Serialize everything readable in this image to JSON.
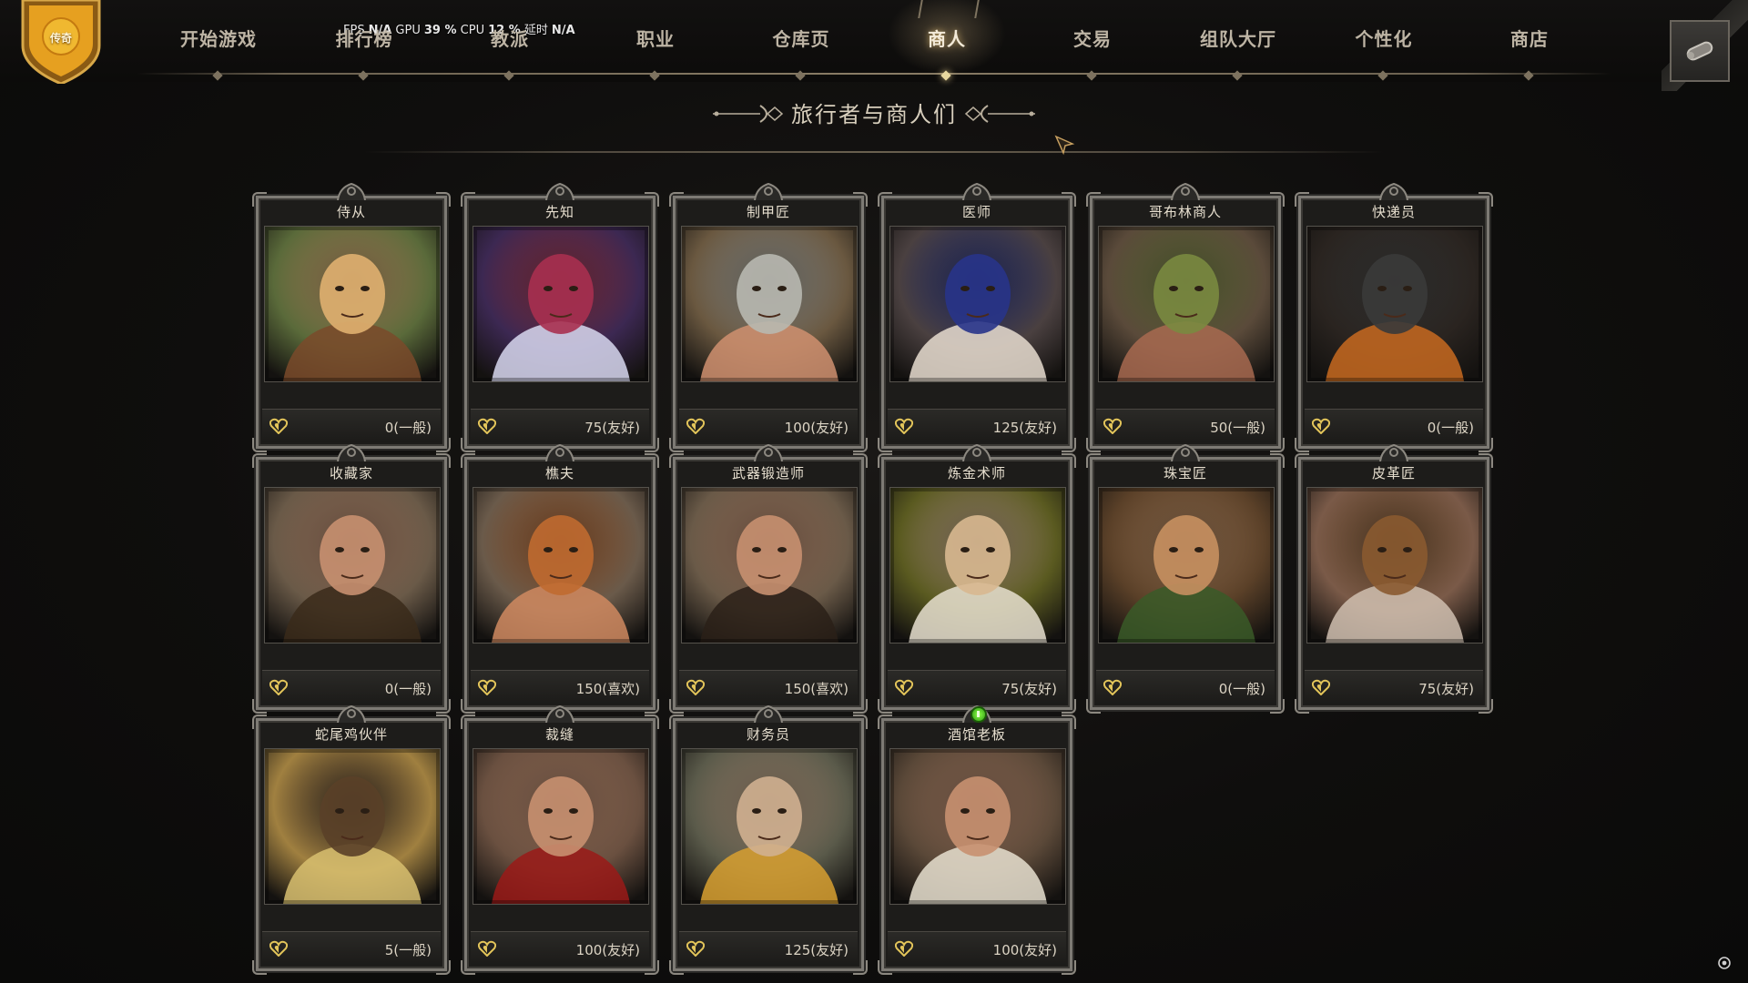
{
  "rank": {
    "label": "传奇"
  },
  "perf": {
    "fps_label": "FPS",
    "fps_value": "N/A",
    "gpu_label": "GPU",
    "gpu_value": "39 %",
    "cpu_label": "CPU",
    "cpu_value": "12 %",
    "latency_label": "延时",
    "latency_value": "N/A"
  },
  "nav": {
    "active": "商人",
    "items": [
      "开始游戏",
      "排行榜",
      "教派",
      "职业",
      "仓库页",
      "商人",
      "交易",
      "组队大厅",
      "个性化",
      "商店"
    ]
  },
  "section": {
    "title": "旅行者与商人们"
  },
  "colors": {
    "accent_gold": "#e3c55a",
    "alert_green": "#5ad12a",
    "text_light": "#e6dece"
  },
  "merchants": [
    {
      "name": "侍从",
      "rep": "0(一般)",
      "palette": [
        "#5a6a3a",
        "#e0b070",
        "#7a4a2a"
      ]
    },
    {
      "name": "先知",
      "rep": "75(友好)",
      "palette": [
        "#3c2852",
        "#a83050",
        "#d8d8f0"
      ]
    },
    {
      "name": "制甲匠",
      "rep": "100(友好)",
      "palette": [
        "#6a5840",
        "#b8b8b0",
        "#d09070"
      ]
    },
    {
      "name": "医师",
      "rep": "125(友好)",
      "palette": [
        "#4a4040",
        "#28348a",
        "#e8ddd0"
      ]
    },
    {
      "name": "哥布林商人",
      "rep": "50(一般)",
      "palette": [
        "#5a4a3a",
        "#7a8a40",
        "#a86a50"
      ]
    },
    {
      "name": "快递员",
      "rep": "0(一般)",
      "palette": [
        "#2a2420",
        "#3a3a3a",
        "#c86a20"
      ]
    },
    {
      "name": "收藏家",
      "rep": "0(一般)",
      "palette": [
        "#6a5a48",
        "#c89070",
        "#3a2a1a"
      ]
    },
    {
      "name": "樵夫",
      "rep": "150(喜欢)",
      "palette": [
        "#6a5a4a",
        "#c06a30",
        "#d08a60"
      ]
    },
    {
      "name": "武器锻造师",
      "rep": "150(喜欢)",
      "palette": [
        "#6a5a48",
        "#c89070",
        "#2a2018"
      ]
    },
    {
      "name": "炼金术师",
      "rep": "75(友好)",
      "palette": [
        "#5a5a20",
        "#d8b890",
        "#e8e0d0"
      ]
    },
    {
      "name": "珠宝匠",
      "rep": "0(一般)",
      "palette": [
        "#5a4028",
        "#c89060",
        "#3a5a28"
      ]
    },
    {
      "name": "皮革匠",
      "rep": "75(友好)",
      "palette": [
        "#7a5a48",
        "#8a5a30",
        "#d0c0b0"
      ]
    },
    {
      "name": "蛇尾鸡伙伴",
      "rep": "5(一般)",
      "palette": [
        "#a08040",
        "#5a4028",
        "#d8c070"
      ]
    },
    {
      "name": "裁缝",
      "rep": "100(友好)",
      "palette": [
        "#6a5040",
        "#c89070",
        "#9a1a18"
      ]
    },
    {
      "name": "财务员",
      "rep": "125(友好)",
      "palette": [
        "#5a5a4a",
        "#d0b090",
        "#d8a030"
      ]
    },
    {
      "name": "酒馆老板",
      "rep": "100(友好)",
      "palette": [
        "#5a4838",
        "#c89070",
        "#e8e0d0"
      ],
      "alert": true
    }
  ]
}
